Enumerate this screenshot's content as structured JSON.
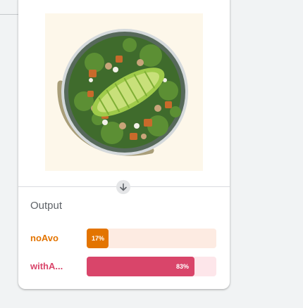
{
  "output": {
    "title": "Output",
    "rows": [
      {
        "label": "noAvo",
        "value": 0.17,
        "percent_label": "17%",
        "color": "#e37400",
        "track_color": "#fdebe2"
      },
      {
        "label": "withA...",
        "value": 0.83,
        "percent_label": "83%",
        "color": "#d9456a",
        "track_color": "#fde6ea"
      }
    ]
  },
  "icons": {
    "expand": "arrow-down-icon"
  }
}
